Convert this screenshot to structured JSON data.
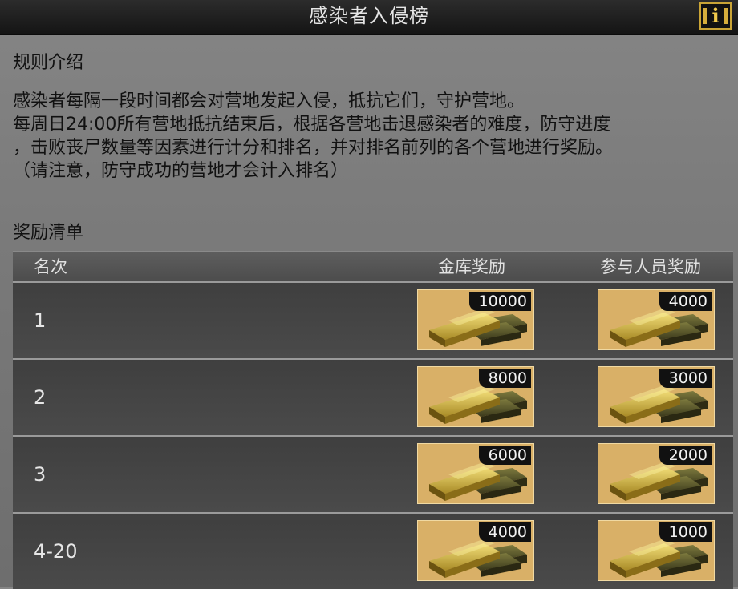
{
  "header": {
    "title": "感染者入侵榜",
    "info_icon": "info-icon"
  },
  "rules": {
    "heading": "规则介绍",
    "lines": [
      "感染者每隔一段时间都会对营地发起入侵，抵抗它们，守护营地。",
      "每周日24:00所有营地抵抗结束后，根据各营地击退感染者的难度，防守进度",
      "，击败丧尸数量等因素进行计分和排名，并对排名前列的各个营地进行奖励。",
      "（请注意，防守成功的营地才会计入排名）"
    ]
  },
  "rewards": {
    "heading": "奖励清单",
    "columns": {
      "rank": "名次",
      "vault": "金库奖励",
      "participant": "参与人员奖励"
    },
    "reward_icon": "gold-bars-icon",
    "rows": [
      {
        "rank": "1",
        "vault": "10000",
        "participant": "4000"
      },
      {
        "rank": "2",
        "vault": "8000",
        "participant": "3000"
      },
      {
        "rank": "3",
        "vault": "6000",
        "participant": "2000"
      },
      {
        "rank": "4-20",
        "vault": "4000",
        "participant": "1000"
      }
    ]
  }
}
